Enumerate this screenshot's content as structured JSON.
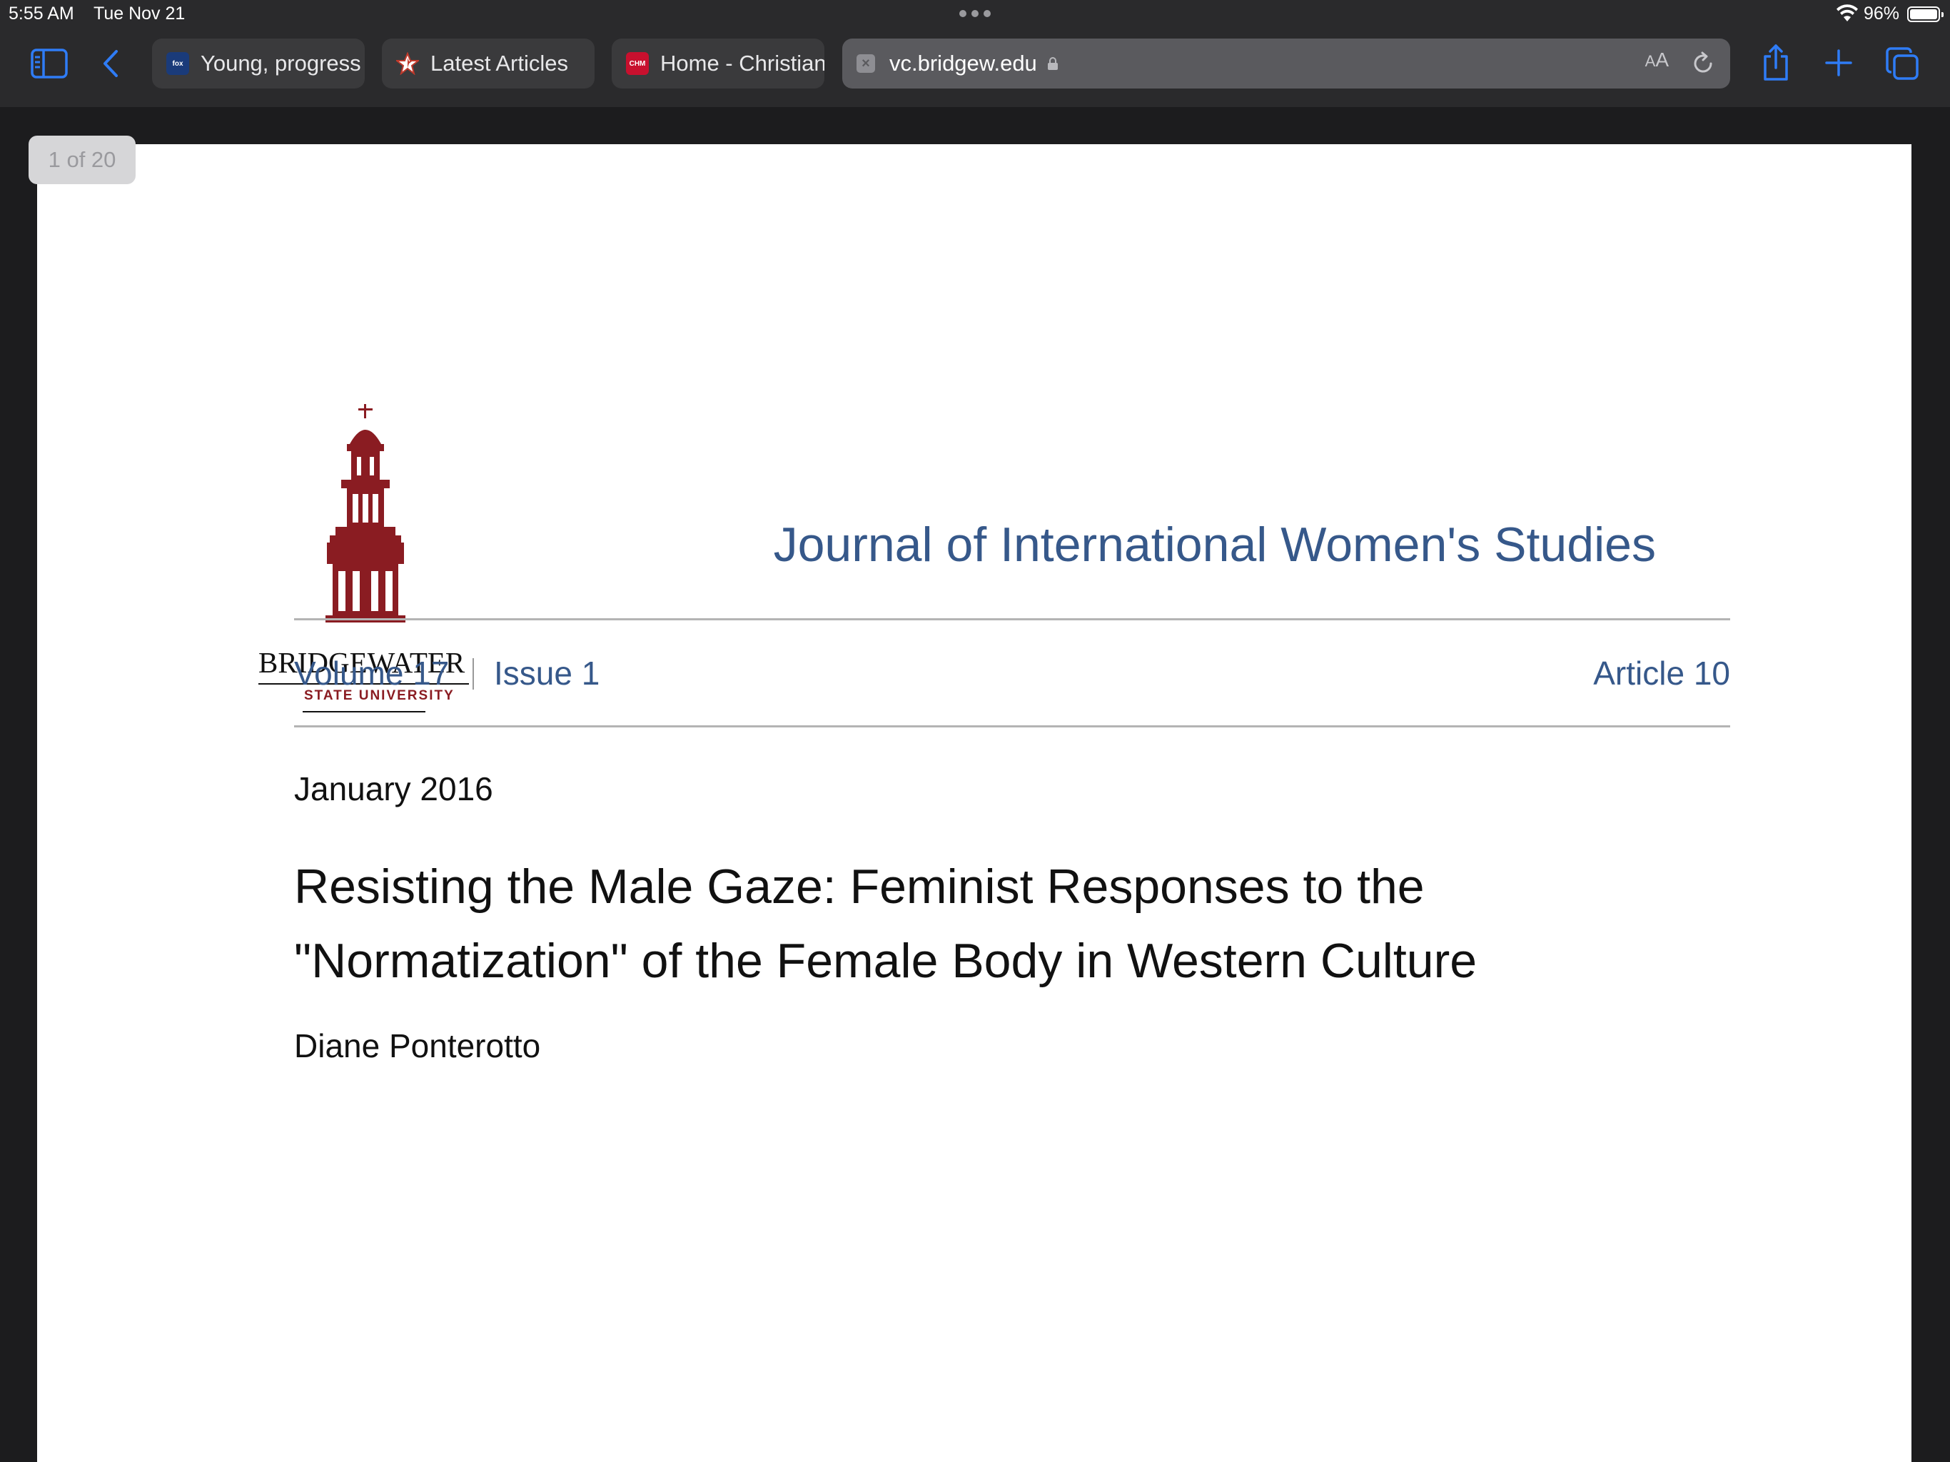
{
  "status_bar": {
    "time": "5:55 AM",
    "date": "Tue Nov 21",
    "battery_percent": "96%"
  },
  "tabs": [
    {
      "label": "Young, progress",
      "favicon": "fox-news-icon",
      "color": "#1a3b7a"
    },
    {
      "label": "Latest Articles",
      "favicon": "texas-star-icon",
      "color": "#c0392b"
    },
    {
      "label": "Home - Christian",
      "favicon": "cnn-icon",
      "color": "#c8102e"
    }
  ],
  "address_bar": {
    "url": "vc.bridgew.edu",
    "reader_label_small": "A",
    "reader_label_large": "A"
  },
  "document": {
    "page_counter": "1 of 20",
    "logo": {
      "wordmark": "BRIDGEWATER",
      "subtitle": "STATE UNIVERSITY"
    },
    "journal_title": "Journal of International Women's Studies",
    "volume": "Volume 17",
    "issue": "Issue 1",
    "article_number": "Article 10",
    "date": "January 2016",
    "title_line1": "Resisting the Male Gaze: Feminist Responses to the",
    "title_line2": "\"Normatization\" of the Female Body in Western Culture",
    "author": "Diane Ponterotto"
  },
  "colors": {
    "accent_blue": "#2f7cf6",
    "journal_blue": "#36588a",
    "logo_red": "#8a1c22"
  }
}
